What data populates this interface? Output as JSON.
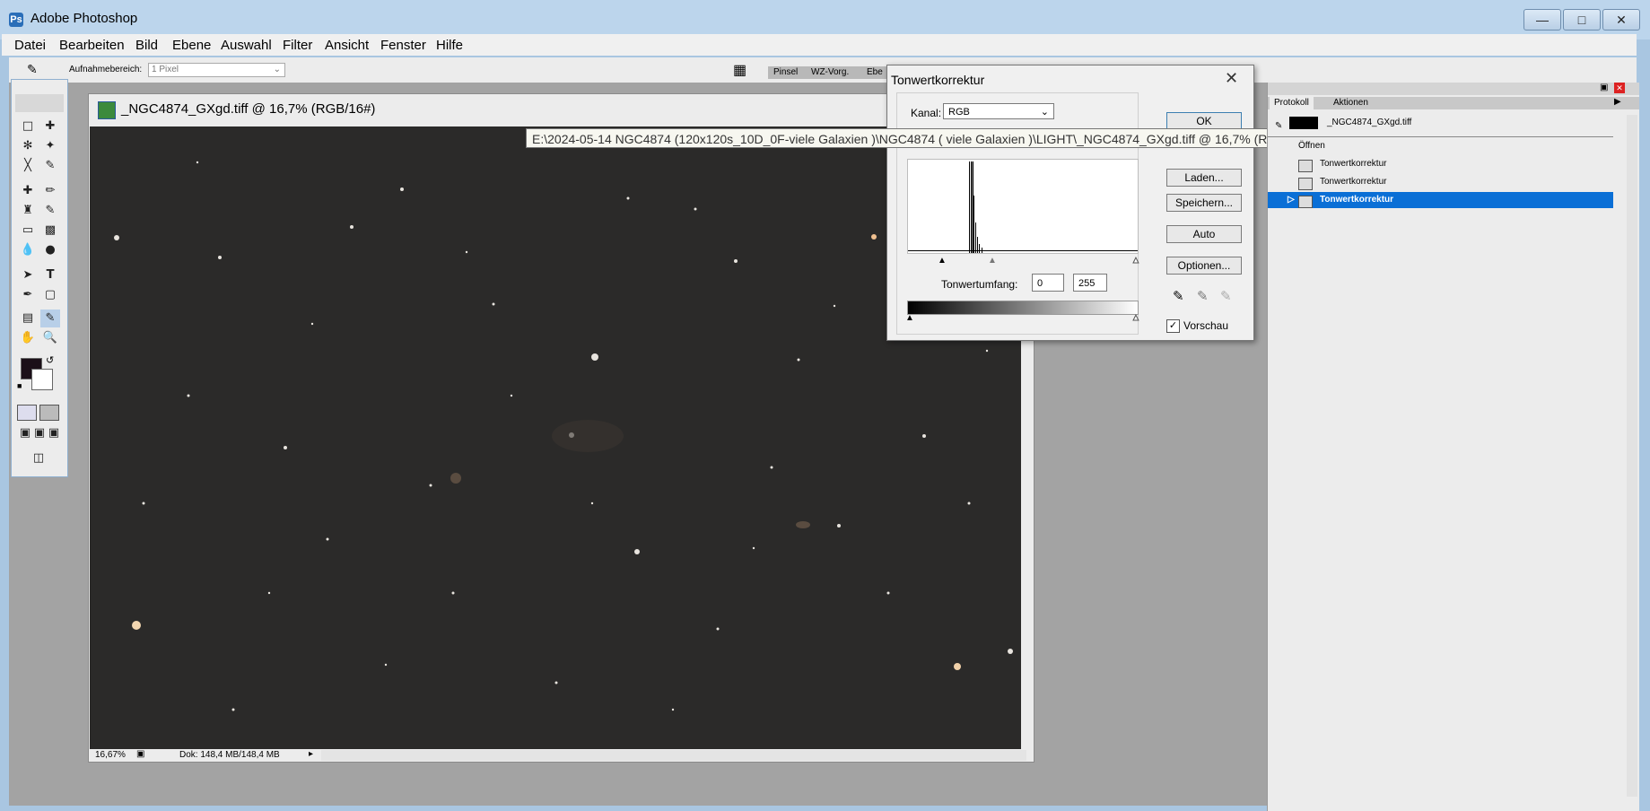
{
  "app": {
    "title": "Adobe Photoshop"
  },
  "menu": [
    "Datei",
    "Bearbeiten",
    "Bild",
    "Ebene",
    "Auswahl",
    "Filter",
    "Ansicht",
    "Fenster",
    "Hilfe"
  ],
  "optbar": {
    "label": "Aufnahmebereich:",
    "value": "1 Pixel",
    "dock_tabs": [
      "Pinsel",
      "WZ-Vorg.",
      "Ebe"
    ]
  },
  "document": {
    "title": "_NGC4874_GXgd.tiff @ 16,7% (RGB/16#)",
    "zoom": "16,67%",
    "size_info": "Dok: 148,4 MB/148,4 MB"
  },
  "tooltip": "E:\\2024-05-14 NGC4874 (120x120s_10D_0F-viele Galaxien )\\NGC4874 ( viele Galaxien )\\LIGHT\\_NGC4874_GXgd.tiff @ 16,7% (RGB/16#)",
  "dialog": {
    "title": "Tonwertkorrektur",
    "channel_label": "Kanal:",
    "channel_value": "RGB",
    "buttons": {
      "ok": "OK",
      "load": "Laden...",
      "save": "Speichern...",
      "auto": "Auto",
      "options": "Optionen..."
    },
    "output_label": "Tonwertumfang:",
    "output_min": "0",
    "output_max": "255",
    "preview_label": "Vorschau",
    "preview_checked": true
  },
  "panel": {
    "tabs": [
      "Protokoll",
      "Aktionen"
    ],
    "snapshot": "_NGC4874_GXgd.tiff",
    "history": [
      "Öffnen",
      "Tonwertkorrektur",
      "Tonwertkorrektur",
      "Tonwertkorrektur"
    ],
    "selected_index": 3
  }
}
